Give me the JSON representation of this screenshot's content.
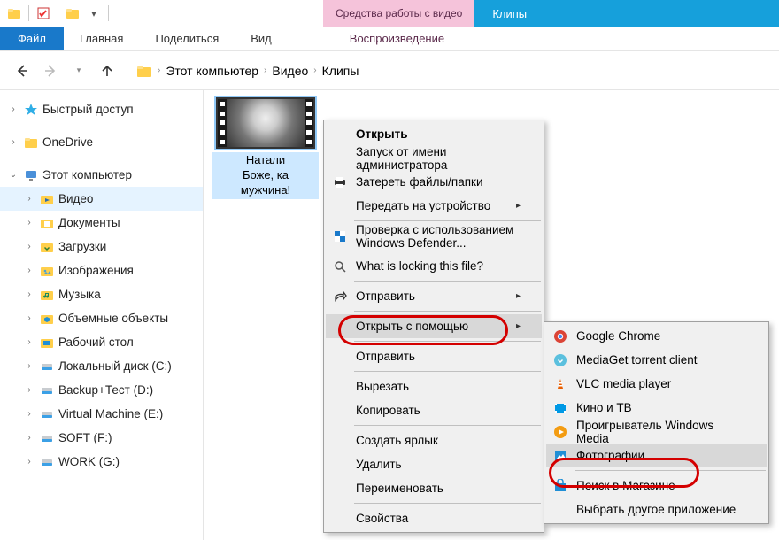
{
  "titlebar": {
    "category_tab": "Средства работы с видео",
    "title": "Клипы"
  },
  "ribbon": {
    "file": "Файл",
    "tabs": [
      "Главная",
      "Поделиться",
      "Вид"
    ],
    "pink_tab": "Воспроизведение"
  },
  "breadcrumb": {
    "items": [
      "Этот компьютер",
      "Видео",
      "Клипы"
    ]
  },
  "sidebar": {
    "quick_access": "Быстрый доступ",
    "onedrive": "OneDrive",
    "this_pc": "Этот компьютер",
    "children": [
      {
        "label": "Видео",
        "icon": "video",
        "selected": true
      },
      {
        "label": "Документы",
        "icon": "docs"
      },
      {
        "label": "Загрузки",
        "icon": "downloads"
      },
      {
        "label": "Изображения",
        "icon": "images"
      },
      {
        "label": "Музыка",
        "icon": "music"
      },
      {
        "label": "Объемные объекты",
        "icon": "3d"
      },
      {
        "label": "Рабочий стол",
        "icon": "desktop"
      },
      {
        "label": "Локальный диск (C:)",
        "icon": "drive"
      },
      {
        "label": "Backup+Тест (D:)",
        "icon": "drive"
      },
      {
        "label": "Virtual Machine (E:)",
        "icon": "drive"
      },
      {
        "label": "SOFT (F:)",
        "icon": "drive"
      },
      {
        "label": "WORK (G:)",
        "icon": "drive"
      }
    ]
  },
  "file": {
    "name_l1": "Натали",
    "name_l2": "Боже, ка",
    "name_l3": "мужчина!"
  },
  "context_menu": {
    "open": "Открыть",
    "run_as_admin": "Запуск от имени администратора",
    "erase": "Затереть файлы/папки",
    "cast": "Передать на устройство",
    "defender": "Проверка с использованием Windows Defender...",
    "locking": "What is locking this file?",
    "send_to": "Отправить",
    "open_with": "Открыть с помощью",
    "share": "Отправить",
    "cut": "Вырезать",
    "copy": "Копировать",
    "shortcut": "Создать ярлык",
    "delete": "Удалить",
    "rename": "Переименовать",
    "properties": "Свойства"
  },
  "submenu": {
    "chrome": "Google Chrome",
    "mediaget": "MediaGet torrent client",
    "vlc": "VLC media player",
    "cinema": "Кино и ТВ",
    "wmp": "Проигрыватель Windows Media",
    "photos": "Фотографии",
    "store": "Поиск в Магазине",
    "other": "Выбрать другое приложение"
  }
}
